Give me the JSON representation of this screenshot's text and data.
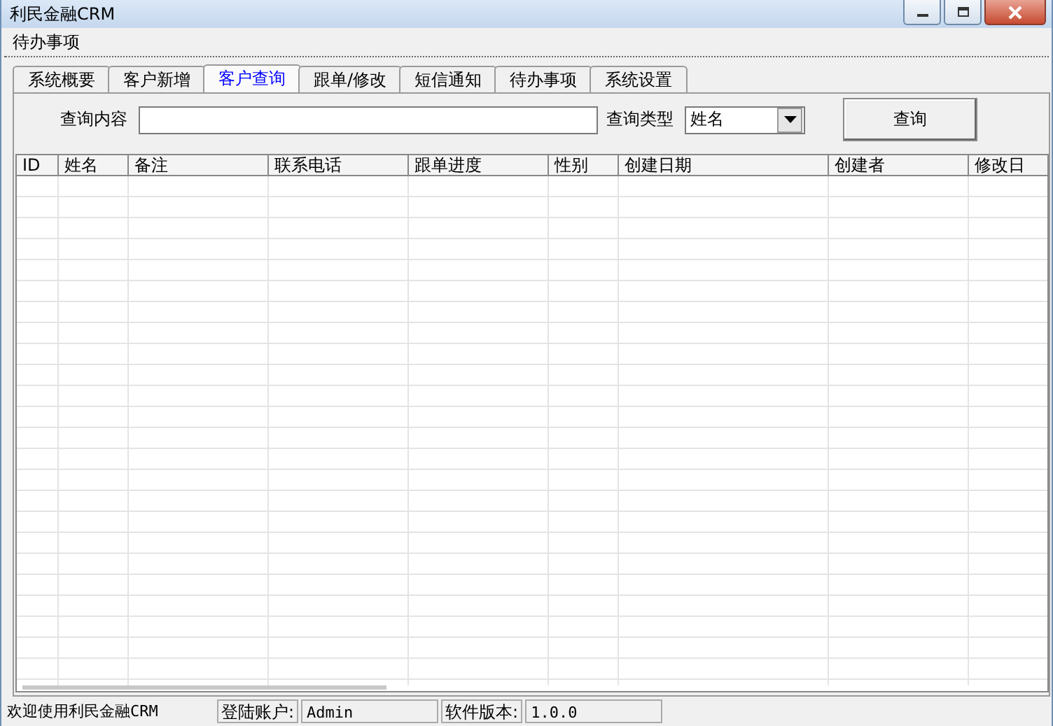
{
  "window": {
    "title": "利民金融CRM"
  },
  "menu": [
    "待办事项"
  ],
  "tabs": [
    {
      "label": "系统概要",
      "selected": false
    },
    {
      "label": "客户新增",
      "selected": false
    },
    {
      "label": "客户查询",
      "selected": true
    },
    {
      "label": "跟单/修改",
      "selected": false
    },
    {
      "label": "短信通知",
      "selected": false
    },
    {
      "label": "待办事项",
      "selected": false
    },
    {
      "label": "系统设置",
      "selected": false
    }
  ],
  "search": {
    "label": "查询内容",
    "type_label": "查询类型",
    "type_value": "姓名",
    "button": "查询"
  },
  "table": {
    "columns": [
      "ID",
      "姓名",
      "备注",
      "联系电话",
      "跟单进度",
      "性别",
      "创建日期",
      "创建者",
      "修改日"
    ]
  },
  "status_bar": [
    {
      "kind": "text",
      "text": "欢迎使用利民金融CRM"
    },
    {
      "kind": "label",
      "text": "登陆账户:"
    },
    {
      "kind": "value",
      "text": "Admin"
    },
    {
      "kind": "label",
      "text": "软件版本:"
    },
    {
      "kind": "value",
      "text": "1.0.0"
    }
  ]
}
